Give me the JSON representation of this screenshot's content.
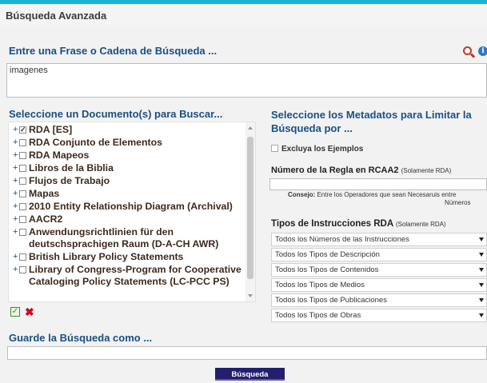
{
  "header": {
    "title": "Búsqueda Avanzada"
  },
  "phrase": {
    "title": "Entre una Frase o Cadena de Búsqueda ...",
    "value": "imagenes",
    "info_glyph": "i"
  },
  "documents": {
    "title": "Seleccione un Documento(s) para Buscar...",
    "items": [
      {
        "label": "RDA [ES]",
        "checked": true
      },
      {
        "label": "RDA Conjunto de Elementos",
        "checked": false
      },
      {
        "label": "RDA Mapeos",
        "checked": false
      },
      {
        "label": "Libros de la Biblia",
        "checked": false
      },
      {
        "label": "Flujos de Trabajo",
        "checked": false
      },
      {
        "label": "Mapas",
        "checked": false
      },
      {
        "label": "2010 Entity Relationship Diagram (Archival)",
        "checked": false
      },
      {
        "label": "AACR2",
        "checked": false
      },
      {
        "label": "Anwendungsrichtlinien für den deutschsprachigen Raum (D-A-CH AWR)",
        "checked": false
      },
      {
        "label": "British Library Policy Statements",
        "checked": false
      },
      {
        "label": "Library of Congress-Program for Cooperative Cataloging Policy Statements (LC-PCC PS)",
        "checked": false
      }
    ],
    "plus_glyph": "+"
  },
  "metadata": {
    "title": "Seleccione los Metadatos para Limitar la Búsqueda por ...",
    "exclude_label": "Excluya los Ejemplos",
    "rule_title": "Número de la Regla en RCAA2",
    "rule_note": "(Solamente RDA)",
    "hint_label": "Consejo:",
    "hint_text": " Entre los Operadores que sean Necesaruis entre",
    "hint_text2": "Números",
    "instr_title": "Tipos de Instrucciones RDA",
    "instr_note": "(Solamente RDA)",
    "selects": [
      "Todos los Números de las Instrucciones",
      "Todos los Tipos de Descripción",
      "Todos los Tipos de Contenidos",
      "Todos los Tipos de Medios",
      "Todos los Tipos de Publicaciones",
      "Todos los Tipos de Obras"
    ]
  },
  "save": {
    "title": "Guarde la Búsqueda como ..."
  },
  "search_button": "Búsqueda",
  "colors": {
    "accent": "#1ab3d6",
    "title_blue": "#1b4f86",
    "button": "#231f6e",
    "delete_red": "#d0021b"
  },
  "icons": [
    "magnifier-zoom-icon",
    "info-icon",
    "check-all-icon",
    "delete-icon",
    "scroll-up-arrow-icon",
    "scroll-down-arrow-icon"
  ]
}
